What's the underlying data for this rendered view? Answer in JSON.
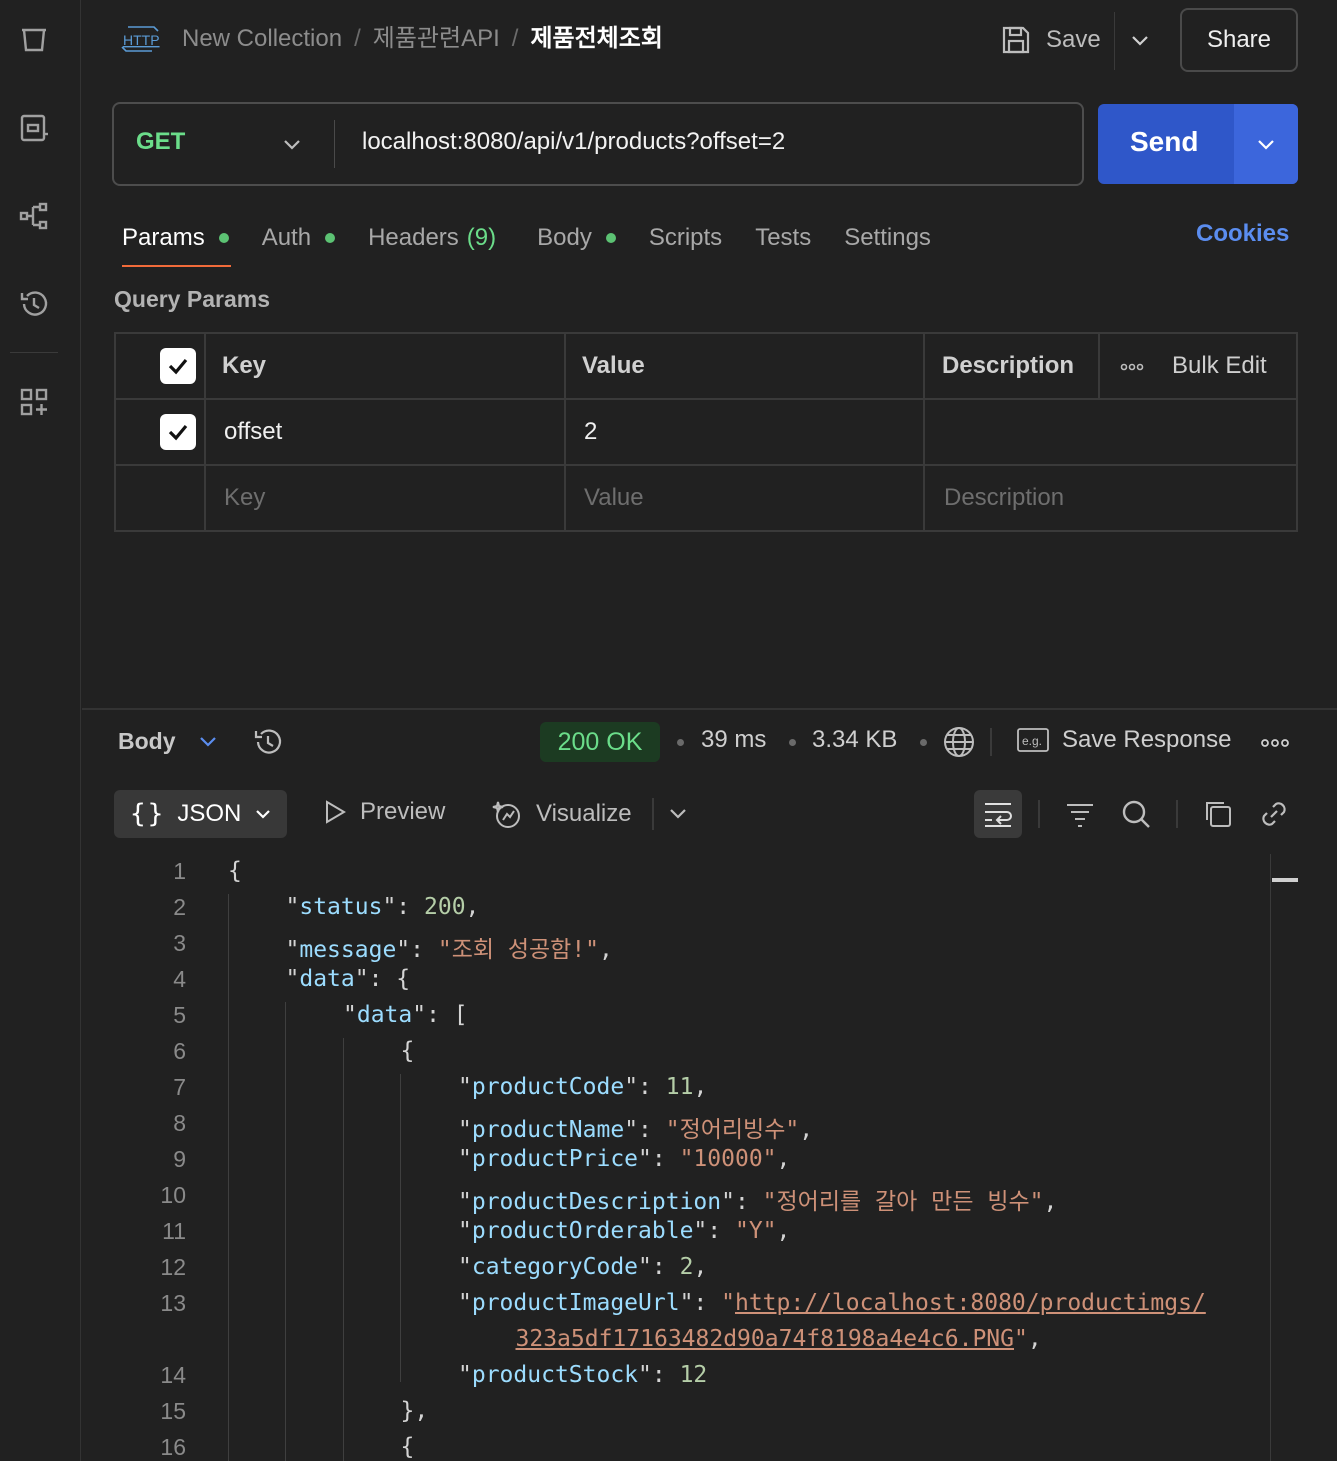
{
  "sidebar": {
    "icons": [
      "collections-icon",
      "environments-icon",
      "flows-icon",
      "history-icon",
      "add-workspace-icon"
    ]
  },
  "header": {
    "badge": "HTTP",
    "breadcrumb": [
      "New Collection",
      "제품관련API"
    ],
    "current": "제품전체조회",
    "save_label": "Save",
    "share_label": "Share"
  },
  "request": {
    "method": "GET",
    "url": "localhost:8080/api/v1/products?offset=2",
    "send_label": "Send"
  },
  "tabs": [
    {
      "label": "Params",
      "dot": true
    },
    {
      "label": "Auth",
      "dot": true
    },
    {
      "label": "Headers",
      "count": "(9)"
    },
    {
      "label": "Body",
      "dot": true
    },
    {
      "label": "Scripts"
    },
    {
      "label": "Tests"
    },
    {
      "label": "Settings"
    }
  ],
  "cookies_label": "Cookies",
  "query_params": {
    "title": "Query Params",
    "headers": {
      "key": "Key",
      "value": "Value",
      "description": "Description",
      "bulk_edit": "Bulk Edit"
    },
    "rows": [
      {
        "key": "offset",
        "value": "2",
        "description": "",
        "checked": true
      }
    ],
    "placeholder": {
      "key": "Key",
      "value": "Value",
      "description": "Description"
    }
  },
  "response": {
    "body_label": "Body",
    "status": "200 OK",
    "time": "39 ms",
    "size": "3.34 KB",
    "save_response": "Save Response",
    "format": "JSON",
    "preview": "Preview",
    "visualize": "Visualize",
    "lines": [
      {
        "n": "1",
        "t": "{"
      },
      {
        "n": "2",
        "k": "status",
        "v": "200",
        "vt": "n",
        "end": ","
      },
      {
        "n": "3",
        "k": "message",
        "v": "\"조회 성공함!\"",
        "vt": "s",
        "end": ","
      },
      {
        "n": "4",
        "k": "data",
        "v": "{",
        "vt": "p"
      },
      {
        "n": "5",
        "k": "data",
        "v": "[",
        "vt": "p"
      },
      {
        "n": "6",
        "t": "{"
      },
      {
        "n": "7",
        "k": "productCode",
        "v": "11",
        "vt": "n",
        "end": ","
      },
      {
        "n": "8",
        "k": "productName",
        "v": "\"정어리빙수\"",
        "vt": "s",
        "end": ","
      },
      {
        "n": "9",
        "k": "productPrice",
        "v": "\"10000\"",
        "vt": "s",
        "end": ","
      },
      {
        "n": "10",
        "k": "productDescription",
        "v": "\"정어리를 갈아 만든 빙수\"",
        "vt": "s",
        "end": ","
      },
      {
        "n": "11",
        "k": "productOrderable",
        "v": "\"Y\"",
        "vt": "s",
        "end": ","
      },
      {
        "n": "12",
        "k": "categoryCode",
        "v": "2",
        "vt": "n",
        "end": ","
      },
      {
        "n": "13",
        "k": "productImageUrl",
        "v": "http://localhost:8080/productimgs/",
        "v2": "323a5df17163482d90a74f8198a4e4c6.PNG"
      },
      {
        "n": "14",
        "k": "productStock",
        "v": "12",
        "vt": "n"
      },
      {
        "n": "15",
        "t": "},"
      },
      {
        "n": "16",
        "t": "{"
      }
    ]
  }
}
